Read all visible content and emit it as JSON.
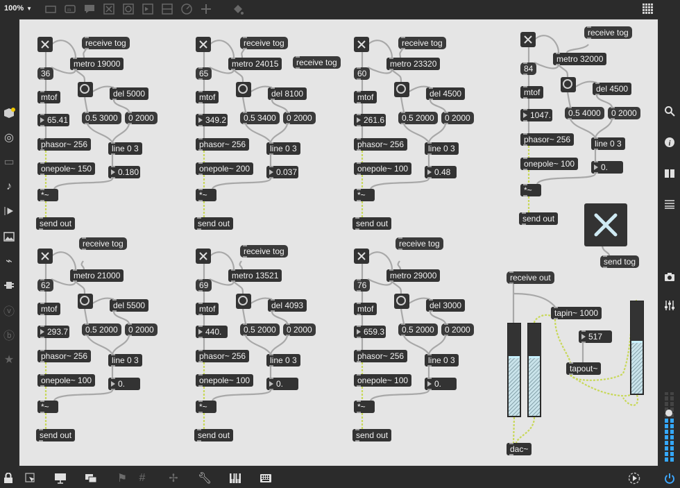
{
  "toolbar": {
    "zoom_label": "100%"
  },
  "patches": [
    {
      "receive": "receive tog",
      "metro": "metro 19000",
      "msg": "36",
      "mtof": "mtof",
      "del": "del 5000",
      "ramp_a": "0.5 3000",
      "ramp_b": "0 2000",
      "freq": "65.41",
      "phasor": "phasor~ 256",
      "line": "line 0 3",
      "onepole": "onepole~ 150",
      "gain": "0.180",
      "mul": "*~",
      "send": "send out"
    },
    {
      "receive": "receive tog",
      "metro": "metro 24015",
      "msg": "65",
      "mtof": "mtof",
      "del": "del 8100",
      "ramp_a": "0.5 3400",
      "ramp_b": "0 2000",
      "freq": "349.2",
      "phasor": "phasor~ 256",
      "line": "line 0 3",
      "onepole": "onepole~ 200",
      "gain": "0.037",
      "mul": "*~",
      "send": "send out"
    },
    {
      "receive": "receive tog",
      "metro": "metro 23320",
      "msg": "60",
      "mtof": "mtof",
      "del": "del 4500",
      "ramp_a": "0.5 2000",
      "ramp_b": "0 2000",
      "freq": "261.6",
      "phasor": "phasor~ 256",
      "line": "line 0 3",
      "onepole": "onepole~ 100",
      "gain": "0.48",
      "mul": "*~",
      "send": "send out"
    },
    {
      "receive": "receive tog",
      "metro": "metro 32000",
      "msg": "84",
      "mtof": "mtof",
      "del": "del 4500",
      "ramp_a": "0.5 4000",
      "ramp_b": "0 2000",
      "freq": "1047.",
      "phasor": "phasor~ 256",
      "line": "line 0 3",
      "onepole": "onepole~ 100",
      "gain": "0.",
      "mul": "*~",
      "send": "send out"
    },
    {
      "receive": "receive tog",
      "metro": "metro 21000",
      "msg": "62",
      "mtof": "mtof",
      "del": "del 5500",
      "ramp_a": "0.5 2000",
      "ramp_b": "0 2000",
      "freq": "293.7",
      "phasor": "phasor~ 256",
      "line": "line 0 3",
      "onepole": "onepole~ 100",
      "gain": "0.",
      "mul": "*~",
      "send": "send out"
    },
    {
      "receive": "receive tog",
      "metro": "metro 13521",
      "msg": "69",
      "mtof": "mtof",
      "del": "del 4093",
      "ramp_a": "0.5 2000",
      "ramp_b": "0 2000",
      "freq": "440.",
      "phasor": "phasor~ 256",
      "line": "line 0 3",
      "onepole": "onepole~ 100",
      "gain": "0.",
      "mul": "*~",
      "send": "send out"
    },
    {
      "receive": "receive tog",
      "metro": "metro 29000",
      "msg": "76",
      "mtof": "mtof",
      "del": "del 3000",
      "ramp_a": "0.5 2000",
      "ramp_b": "0 2000",
      "freq": "659.3",
      "phasor": "phasor~ 256",
      "line": "line 0 3",
      "onepole": "onepole~ 100",
      "gain": "0.",
      "mul": "*~",
      "send": "send out"
    }
  ],
  "extra_receive": "receive tog",
  "send_tog": "send tog",
  "mixer": {
    "receive": "receive out",
    "tapin": "tapin~ 1000",
    "delay_ms": "517",
    "tapout": "tapout~",
    "dac": "dac~"
  },
  "meters": {
    "left_level": 0.62,
    "right_level": 0.62,
    "tap_level": 0.55,
    "output_level": 0.55
  },
  "colors": {
    "canvas": "#e5e5e5",
    "object": "#333333",
    "cord": "#a8a8a8",
    "signal_cord": "#c8d85a",
    "meter_fill": "#c9e3ea"
  }
}
